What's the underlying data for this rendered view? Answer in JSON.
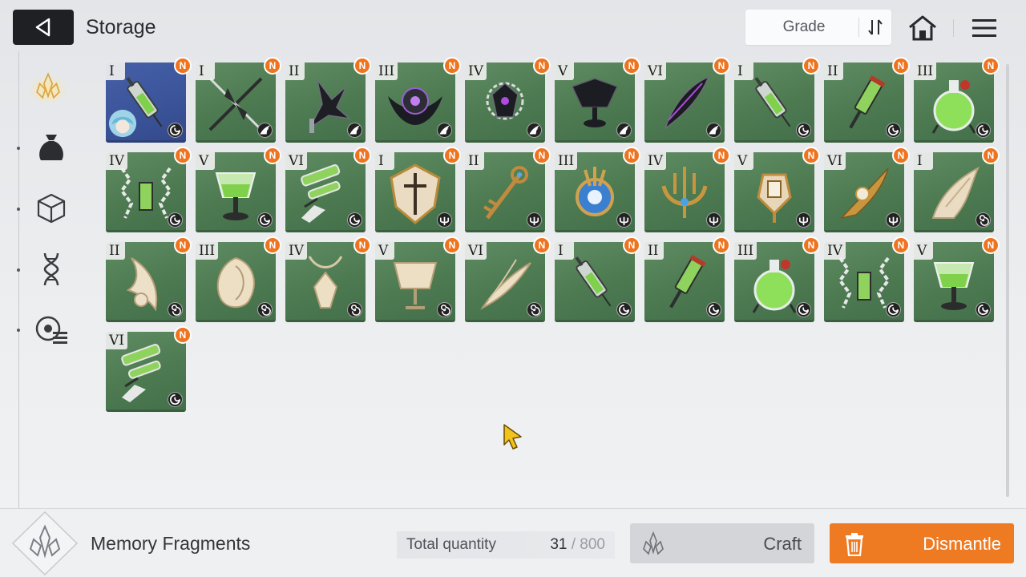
{
  "header": {
    "title": "Storage",
    "sort_label": "Grade"
  },
  "sidebar": {
    "items": [
      {
        "icon": "memory-fragment-icon",
        "active": true
      },
      {
        "icon": "bag-icon",
        "active": false
      },
      {
        "icon": "cube-icon",
        "active": false
      },
      {
        "icon": "dna-icon",
        "active": false
      },
      {
        "icon": "settings-list-icon",
        "active": false
      }
    ]
  },
  "items": [
    {
      "grade": "I",
      "set": "swirl",
      "art": "syringe",
      "selected": true
    },
    {
      "grade": "I",
      "set": "wing",
      "art": "blades"
    },
    {
      "grade": "II",
      "set": "wing",
      "art": "dark-claw"
    },
    {
      "grade": "III",
      "set": "wing",
      "art": "dark-orb"
    },
    {
      "grade": "IV",
      "set": "wing",
      "art": "dark-chain"
    },
    {
      "grade": "V",
      "set": "wing",
      "art": "dark-cup"
    },
    {
      "grade": "VI",
      "set": "wing",
      "art": "dark-feather"
    },
    {
      "grade": "I",
      "set": "swirl",
      "art": "syringe"
    },
    {
      "grade": "II",
      "set": "swirl",
      "art": "vial"
    },
    {
      "grade": "III",
      "set": "swirl",
      "art": "flask"
    },
    {
      "grade": "IV",
      "set": "swirl",
      "art": "chain-vial"
    },
    {
      "grade": "V",
      "set": "swirl",
      "art": "goblet"
    },
    {
      "grade": "VI",
      "set": "swirl",
      "art": "tubes"
    },
    {
      "grade": "I",
      "set": "trident",
      "art": "gold-shield"
    },
    {
      "grade": "II",
      "set": "trident",
      "art": "gold-key"
    },
    {
      "grade": "III",
      "set": "trident",
      "art": "gold-orb"
    },
    {
      "grade": "IV",
      "set": "trident",
      "art": "gold-trident"
    },
    {
      "grade": "V",
      "set": "trident",
      "art": "gold-lantern"
    },
    {
      "grade": "VI",
      "set": "trident",
      "art": "gold-blade"
    },
    {
      "grade": "I",
      "set": "spiral",
      "art": "bone-claw"
    },
    {
      "grade": "II",
      "set": "spiral",
      "art": "bone-wing"
    },
    {
      "grade": "III",
      "set": "spiral",
      "art": "bone-shell"
    },
    {
      "grade": "IV",
      "set": "spiral",
      "art": "bone-pendant"
    },
    {
      "grade": "V",
      "set": "spiral",
      "art": "bone-cup"
    },
    {
      "grade": "VI",
      "set": "spiral",
      "art": "bone-feather"
    },
    {
      "grade": "I",
      "set": "swirl",
      "art": "syringe"
    },
    {
      "grade": "II",
      "set": "swirl",
      "art": "vial"
    },
    {
      "grade": "III",
      "set": "swirl",
      "art": "flask"
    },
    {
      "grade": "IV",
      "set": "swirl",
      "art": "chain-vial"
    },
    {
      "grade": "V",
      "set": "swirl",
      "art": "goblet"
    },
    {
      "grade": "VI",
      "set": "swirl",
      "art": "tubes"
    }
  ],
  "new_badge": "N",
  "footer": {
    "category_label": "Memory Fragments",
    "total_label": "Total quantity",
    "total_count": "31",
    "total_separator": "/",
    "total_max": "800",
    "craft_label": "Craft",
    "dismantle_label": "Dismantle"
  },
  "colors": {
    "accent": "#ee7a22",
    "badge": "#ef7420",
    "cell_green": "#4d7a51",
    "cell_selected": "#3a5399"
  }
}
